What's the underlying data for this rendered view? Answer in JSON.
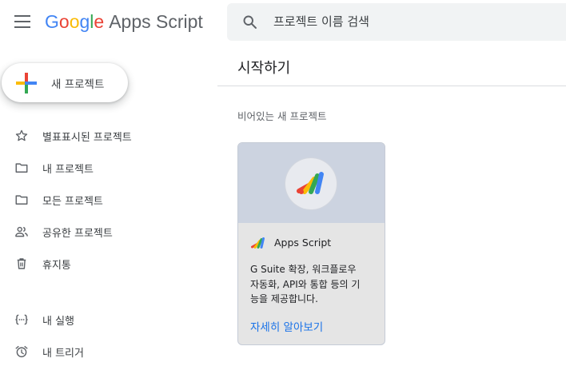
{
  "header": {
    "logo_letters": [
      {
        "ch": "G",
        "color": "#4285F4"
      },
      {
        "ch": "o",
        "color": "#EA4335"
      },
      {
        "ch": "o",
        "color": "#FBBC05"
      },
      {
        "ch": "g",
        "color": "#4285F4"
      },
      {
        "ch": "l",
        "color": "#34A853"
      },
      {
        "ch": "e",
        "color": "#EA4335"
      }
    ],
    "logo_product": "Apps Script",
    "menu_icon": "hamburger-menu-icon"
  },
  "search": {
    "placeholder": "프로젝트 이름 검색",
    "value": "",
    "icon": "search-icon"
  },
  "sidebar": {
    "new_project_label": "새 프로젝트",
    "items": [
      {
        "label": "별표표시된 프로젝트",
        "icon": "star-icon"
      },
      {
        "label": "내 프로젝트",
        "icon": "folder-icon"
      },
      {
        "label": "모든 프로젝트",
        "icon": "folder-icon"
      },
      {
        "label": "공유한 프로젝트",
        "icon": "people-icon"
      },
      {
        "label": "휴지통",
        "icon": "trash-icon"
      }
    ],
    "items2": [
      {
        "label": "내 실행",
        "icon": "executions-icon"
      },
      {
        "label": "내 트리거",
        "icon": "alarm-clock-icon"
      }
    ]
  },
  "main": {
    "section_title": "시작하기",
    "subhead": "비어있는 새 프로젝트",
    "card": {
      "title": "Apps Script",
      "desc_line1": "G Suite 확장, 워크플로우",
      "desc_line2": "자동화, API와 통합 등의 기",
      "desc_line3": "능을 제공합니다.",
      "learn_more": "자세히 알아보기"
    }
  },
  "colors": {
    "accent_blue": "#1a73e8",
    "search_bg": "#f1f3f4",
    "card_hero_bg": "#ccd3e0",
    "card_body_bg": "#e5e5e5"
  }
}
